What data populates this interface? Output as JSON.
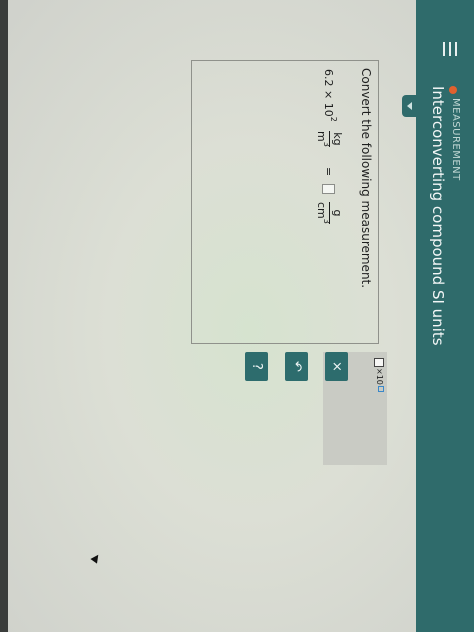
{
  "header": {
    "category": "MEASUREMENT",
    "title": "Interconverting compound SI units",
    "category_dot_color": "#e0612f",
    "bar_color": "#2f6b6b"
  },
  "question": {
    "instruction": "Convert the following measurement.",
    "coefficient": "6.2 × 10",
    "exponent": "2",
    "from_num": "kg",
    "from_den": "m",
    "from_den_exp": "3",
    "equals": "=",
    "to_num": "g",
    "to_den": "cm",
    "to_den_exp": "3"
  },
  "keypad": {
    "sci_label": "×10"
  },
  "actions": {
    "clear": "×",
    "undo": "↶",
    "help": "?"
  }
}
